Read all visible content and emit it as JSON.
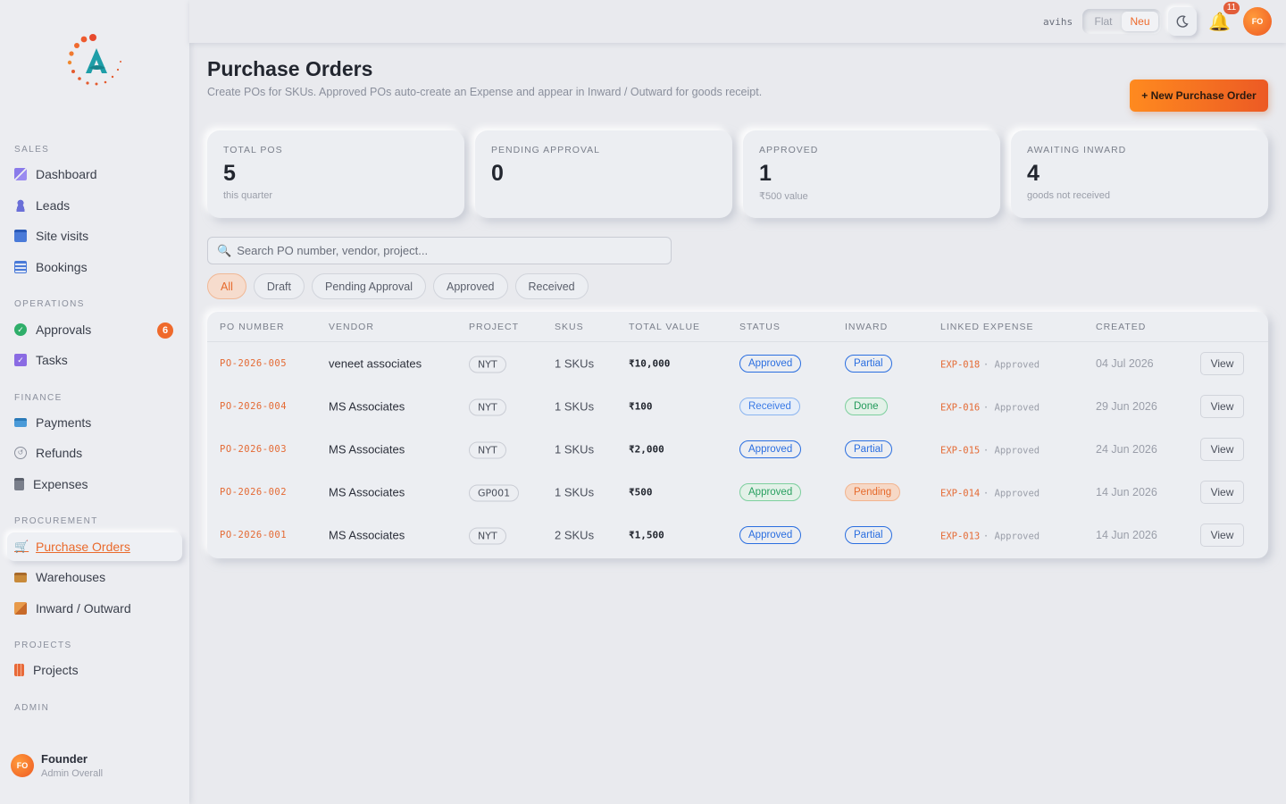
{
  "sidebar": {
    "sections": [
      "SALES",
      "OPERATIONS",
      "FINANCE",
      "PROCUREMENT",
      "PROJECTS",
      "ADMIN"
    ],
    "items": [
      {
        "label": "Dashboard",
        "icon": "grid-icon",
        "color": "#7b6be3"
      },
      {
        "label": "Leads",
        "icon": "person-icon",
        "color": "#6a6fd8"
      },
      {
        "label": "Site visits",
        "icon": "calendar-icon",
        "color": "#4a7ad8"
      },
      {
        "label": "Bookings",
        "icon": "document-icon",
        "color": "#4a7ad8"
      },
      {
        "label": "Approvals",
        "icon": "check-circle-icon",
        "color": "#2fae6a",
        "badge": "6"
      },
      {
        "label": "Tasks",
        "icon": "checkbox-icon",
        "color": "#8a6be3"
      },
      {
        "label": "Payments",
        "icon": "card-icon",
        "color": "#4a9ad8"
      },
      {
        "label": "Refunds",
        "icon": "refund-icon",
        "color": "#8a8f9c"
      },
      {
        "label": "Expenses",
        "icon": "clipboard-icon",
        "color": "#7a7f8b"
      },
      {
        "label": "Purchase Orders",
        "icon": "cart-icon",
        "color": "#e88a2c",
        "active": true
      },
      {
        "label": "Warehouses",
        "icon": "warehouse-icon",
        "color": "#c88a3a"
      },
      {
        "label": "Inward / Outward",
        "icon": "box-icon",
        "color": "#d87a3a"
      },
      {
        "label": "Projects",
        "icon": "building-icon",
        "color": "#e86a3a"
      }
    ],
    "user": {
      "initials": "FO",
      "name": "Founder",
      "role": "Admin Overall"
    }
  },
  "topbar": {
    "username": "avihs",
    "toggle": [
      "Flat",
      "Neu"
    ],
    "notification_count": "11",
    "avatar_initials": "FO"
  },
  "page": {
    "title": "Purchase Orders",
    "subtitle": "Create POs for SKUs. Approved POs auto-create an Expense and appear in Inward / Outward for goods receipt.",
    "new_button": "+ New Purchase Order"
  },
  "stats": [
    {
      "label": "TOTAL POS",
      "value": "5",
      "sub": "this quarter"
    },
    {
      "label": "PENDING APPROVAL",
      "value": "0",
      "sub": ""
    },
    {
      "label": "APPROVED",
      "value": "1",
      "sub": "₹500 value"
    },
    {
      "label": "AWAITING INWARD",
      "value": "4",
      "sub": "goods not received"
    }
  ],
  "search": {
    "placeholder": "Search PO number, vendor, project..."
  },
  "filters": [
    "All",
    "Draft",
    "Pending Approval",
    "Approved",
    "Received"
  ],
  "table": {
    "headers": [
      "PO NUMBER",
      "VENDOR",
      "PROJECT",
      "SKUS",
      "TOTAL VALUE",
      "STATUS",
      "INWARD",
      "LINKED EXPENSE",
      "CREATED"
    ],
    "rows": [
      {
        "po": "PO-2026-005",
        "vendor": "veneet associates",
        "project": "NYT",
        "skus": "1 SKUs",
        "value": "₹10,000",
        "status": "Approved",
        "inward": "Partial",
        "expense": "EXP-018",
        "expense_status": "· Approved",
        "created": "04 Jul 2026",
        "action": "View"
      },
      {
        "po": "PO-2026-004",
        "vendor": "MS Associates",
        "project": "NYT",
        "skus": "1 SKUs",
        "value": "₹100",
        "status": "Received",
        "inward": "Done",
        "expense": "EXP-016",
        "expense_status": "· Approved",
        "created": "29 Jun 2026",
        "action": "View"
      },
      {
        "po": "PO-2026-003",
        "vendor": "MS Associates",
        "project": "NYT",
        "skus": "1 SKUs",
        "value": "₹2,000",
        "status": "Approved",
        "inward": "Partial",
        "expense": "EXP-015",
        "expense_status": "· Approved",
        "created": "24 Jun 2026",
        "action": "View"
      },
      {
        "po": "PO-2026-002",
        "vendor": "MS Associates",
        "project": "GP001",
        "skus": "1 SKUs",
        "value": "₹500",
        "status": "Approved",
        "inward": "Pending",
        "expense": "EXP-014",
        "expense_status": "· Approved",
        "created": "14 Jun 2026",
        "action": "View"
      },
      {
        "po": "PO-2026-001",
        "vendor": "MS Associates",
        "project": "NYT",
        "skus": "2 SKUs",
        "value": "₹1,500",
        "status": "Approved",
        "inward": "Partial",
        "expense": "EXP-013",
        "expense_status": "· Approved",
        "created": "14 Jun 2026",
        "action": "View"
      }
    ]
  },
  "colors": {
    "accent": "#ee6a2c",
    "link": "#e46a34",
    "blue": "#2a6ee0",
    "green": "#29a060"
  }
}
